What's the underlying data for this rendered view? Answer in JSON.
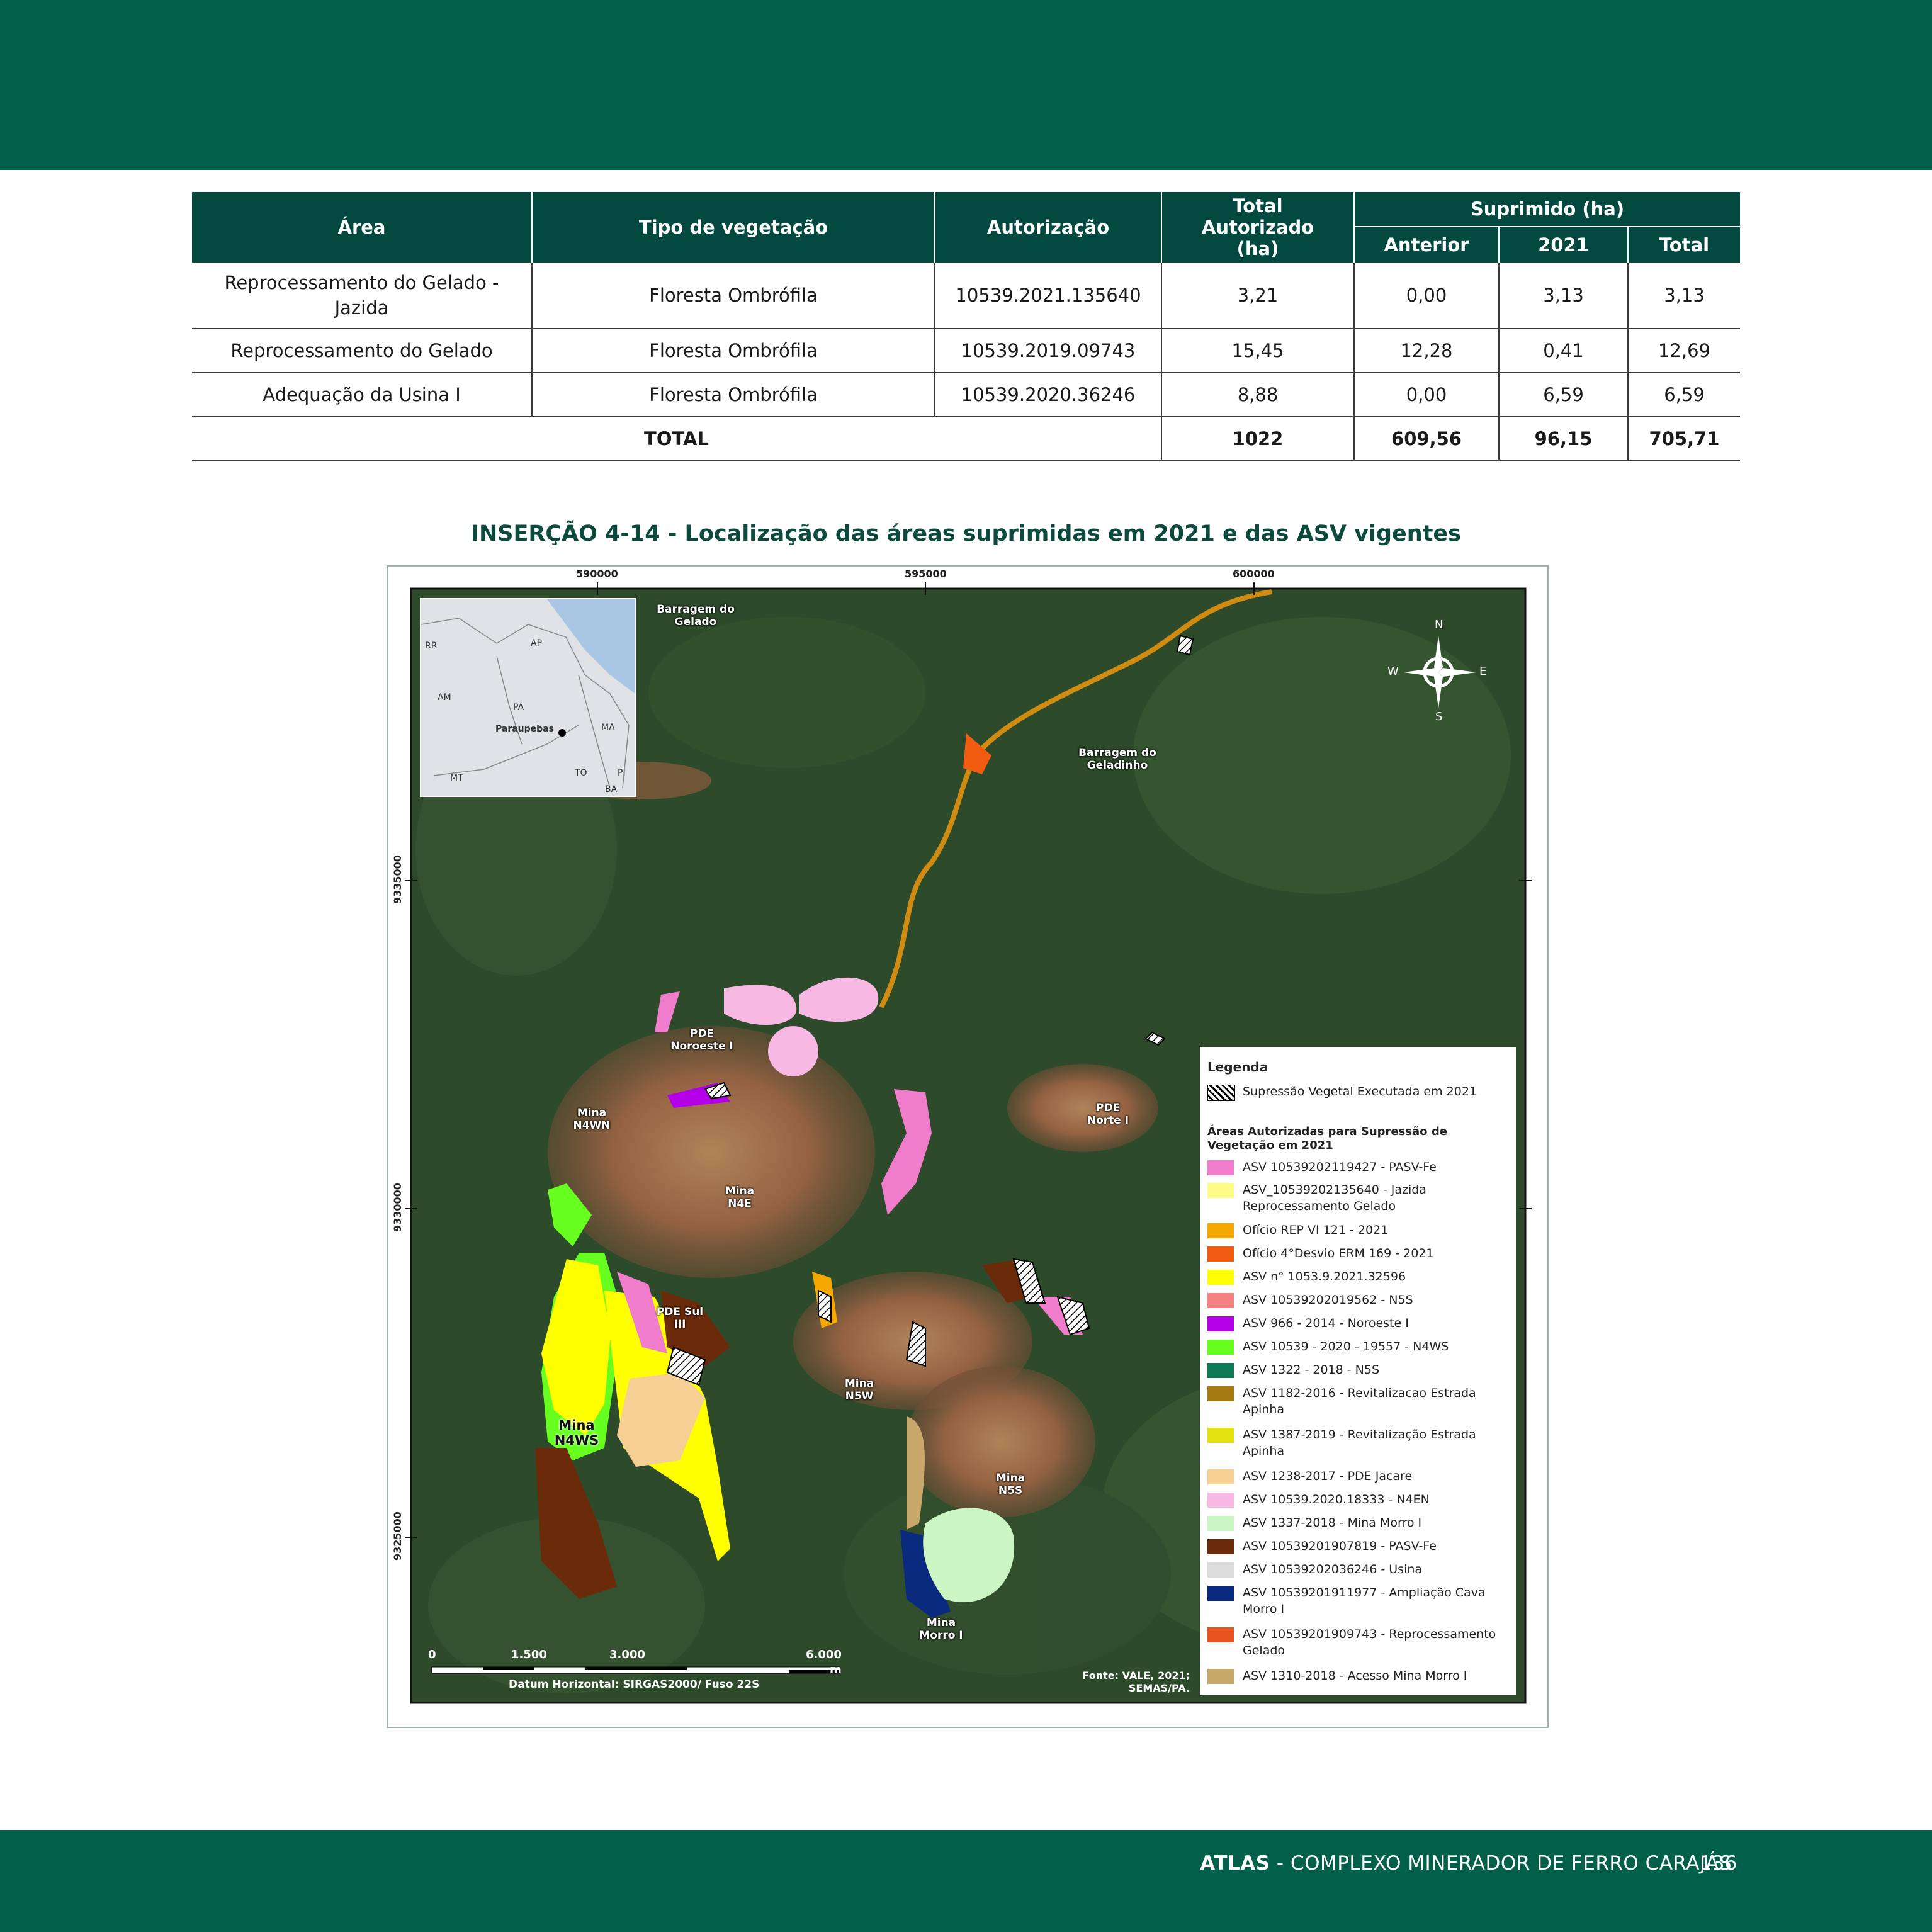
{
  "table": {
    "headers": {
      "area": "Área",
      "vegetation": "Tipo de vegetação",
      "authorization": "Autorização",
      "total_authorized": "Total Autorizado (ha)",
      "suppressed": "Suprimido (ha)",
      "previous": "Anterior",
      "year": "2021",
      "total": "Total"
    },
    "rows": [
      {
        "area": "Reprocessamento do Gelado - Jazida",
        "vegetation": "Floresta Ombrófila",
        "authorization": "10539.2021.135640",
        "total_authorized": "3,21",
        "previous": "0,00",
        "year": "3,13",
        "total": "3,13"
      },
      {
        "area": "Reprocessamento do Gelado",
        "vegetation": "Floresta Ombrófila",
        "authorization": "10539.2019.09743",
        "total_authorized": "15,45",
        "previous": "12,28",
        "year": "0,41",
        "total": "12,69"
      },
      {
        "area": "Adequação da Usina I",
        "vegetation": "Floresta Ombrófila",
        "authorization": "10539.2020.36246",
        "total_authorized": "8,88",
        "previous": "0,00",
        "year": "6,59",
        "total": "6,59"
      }
    ],
    "totals": {
      "label": "TOTAL",
      "total_authorized": "1022",
      "previous": "609,56",
      "year": "96,15",
      "total": "705,71"
    }
  },
  "figure": {
    "caption": "INSERÇÃO 4-14 - Localização das áreas suprimidas em 2021 e das ASV vigentes",
    "coords_top": [
      "590000",
      "595000",
      "600000"
    ],
    "coords_left": [
      "9335000",
      "9330000",
      "9325000"
    ],
    "inset_labels": [
      "RR",
      "AP",
      "AM",
      "PA",
      "Paraupebas",
      "MA",
      "TO",
      "PI",
      "MT",
      "BA"
    ],
    "place_labels": {
      "barragem_gelado": "Barragem do Gelado",
      "barragem_geladinho": "Barragem do Geladinho",
      "pde_noroeste": "PDE Noroeste I",
      "mina_n4wn": "Mina N4WN",
      "mina_n4e": "Mina N4E",
      "pde_norte": "PDE Norte I",
      "pde_sul": "PDE Sul III",
      "mina_n4ws": "Mina N4WS",
      "mina_n5w": "Mina N5W",
      "mina_n5s": "Mina N5S",
      "mina_morro": "Mina Morro I"
    },
    "compass": {
      "n": "N",
      "s": "S",
      "e": "E",
      "w": "W"
    },
    "scale": {
      "s0": "0",
      "s1": "1.500",
      "s2": "3.000",
      "s3": "6.000",
      "unit": "m",
      "datum": "Datum Horizontal: SIRGAS2000/ Fuso 22S"
    },
    "source": "Fonte: VALE, 2021; SEMAS/PA.",
    "legend": {
      "title": "Legenda",
      "hatch_label": "Supressão Vegetal Executada em 2021",
      "areas_heading": "Áreas Autorizadas para Supressão de Vegetação em 2021",
      "items": [
        {
          "label": "ASV 10539202119427 - PASV-Fe",
          "color": "#f07ccc"
        },
        {
          "label": "ASV_10539202135640 - Jazida Reprocessamento Gelado",
          "color": "#fcfc86"
        },
        {
          "label": "Ofício REP VI 121 - 2021",
          "color": "#f5a800"
        },
        {
          "label": "Ofício 4°Desvio ERM 169 - 2021",
          "color": "#f25c10"
        },
        {
          "label": "ASV n° 1053.9.2021.32596",
          "color": "#ffff00"
        },
        {
          "label": "ASV 10539202019562 - N5S",
          "color": "#f58282"
        },
        {
          "label": "ASV 966 - 2014 - Noroeste I",
          "color": "#b300e6"
        },
        {
          "label": "ASV 10539 - 2020 - 19557 - N4WS",
          "color": "#66ff1f"
        },
        {
          "label": "ASV 1322 - 2018 - N5S",
          "color": "#0e7a55"
        },
        {
          "label": "ASV 1182-2016 - Revitalizacao Estrada Apinha",
          "color": "#a67a12"
        },
        {
          "label": "ASV 1387-2019 - Revitalização Estrada Apinha",
          "color": "#e3e312"
        },
        {
          "label": "ASV 1238-2017 - PDE Jacare",
          "color": "#f5cf94"
        },
        {
          "label": "ASV 10539.2020.18333 - N4EN",
          "color": "#f7b8e3"
        },
        {
          "label": "ASV 1337-2018 - Mina Morro I",
          "color": "#ccf5c4"
        },
        {
          "label": "ASV 10539201907819 - PASV-Fe",
          "color": "#6b2a0a"
        },
        {
          "label": "ASV 10539202036246 - Usina",
          "color": "#dcdcdc"
        },
        {
          "label": "ASV 10539201911977 - Ampliação Cava Morro I",
          "color": "#0a2a80"
        },
        {
          "label": "ASV 10539201909743 - Reprocessamento Gelado",
          "color": "#e8521e"
        },
        {
          "label": "ASV 1310-2018 - Acesso Mina Morro I",
          "color": "#c9a86b"
        }
      ]
    }
  },
  "footer": {
    "brand": "ATLAS",
    "title": " - COMPLEXO MINERADOR DE FERRO CARAJÁS",
    "page": "136"
  },
  "colors": {
    "band": "#02604a",
    "header": "#04493f",
    "caption": "#0b4a3c"
  }
}
